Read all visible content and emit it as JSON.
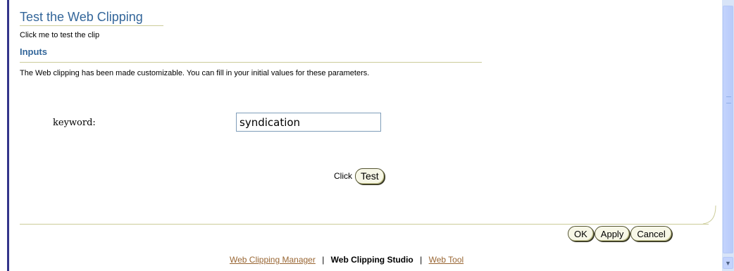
{
  "header": {
    "title": "Test the Web Clipping",
    "subtitle": "Click me to test the clip"
  },
  "inputs": {
    "section_title": "Inputs",
    "description": "The Web clipping has been made customizable. You can fill in your initial values for these parameters.",
    "params": [
      {
        "label": "keyword:",
        "value": "syndication"
      }
    ]
  },
  "test": {
    "click_label": "Click",
    "button_label": "Test"
  },
  "actions": {
    "ok_label": "OK",
    "apply_label": "Apply",
    "cancel_label": "Cancel"
  },
  "footer": {
    "links": [
      {
        "label": "Web Clipping Manager"
      },
      {
        "label": "Web Clipping Studio"
      },
      {
        "label": "Web Tool"
      }
    ],
    "separator": "|"
  },
  "icons": {
    "scroll_down": "chevron-down-icon"
  },
  "colors": {
    "title": "#33669a",
    "rule": "#cccc99",
    "link": "#996633",
    "button_bg": "#f7f7e7"
  }
}
